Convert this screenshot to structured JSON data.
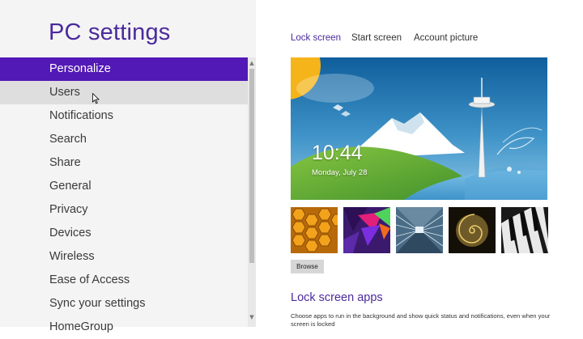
{
  "page_title": "PC settings",
  "nav": {
    "items": [
      {
        "label": "Personalize",
        "state": "selected"
      },
      {
        "label": "Users",
        "state": "hovered"
      },
      {
        "label": "Notifications",
        "state": ""
      },
      {
        "label": "Search",
        "state": ""
      },
      {
        "label": "Share",
        "state": ""
      },
      {
        "label": "General",
        "state": ""
      },
      {
        "label": "Privacy",
        "state": ""
      },
      {
        "label": "Devices",
        "state": ""
      },
      {
        "label": "Wireless",
        "state": ""
      },
      {
        "label": "Ease of Access",
        "state": ""
      },
      {
        "label": "Sync your settings",
        "state": ""
      },
      {
        "label": "HomeGroup",
        "state": ""
      }
    ]
  },
  "tabs": [
    {
      "label": "Lock screen",
      "active": true
    },
    {
      "label": "Start screen",
      "active": false
    },
    {
      "label": "Account picture",
      "active": false
    }
  ],
  "preview": {
    "time": "10:44",
    "date": "Monday, July 28"
  },
  "thumbnails": [
    {
      "icon": "honeycomb-image"
    },
    {
      "icon": "abstract-colors-image"
    },
    {
      "icon": "tunnel-image"
    },
    {
      "icon": "nautilus-shell-image"
    },
    {
      "icon": "piano-keys-image"
    }
  ],
  "browse_label": "Browse",
  "lock_screen_apps": {
    "title": "Lock screen apps",
    "description": "Choose apps to run in the background and show quick status and notifications, even when your screen is locked"
  },
  "colors": {
    "accent": "#5319b6",
    "title": "#4b2a9d",
    "sidebar_bg": "#f4f4f4"
  }
}
